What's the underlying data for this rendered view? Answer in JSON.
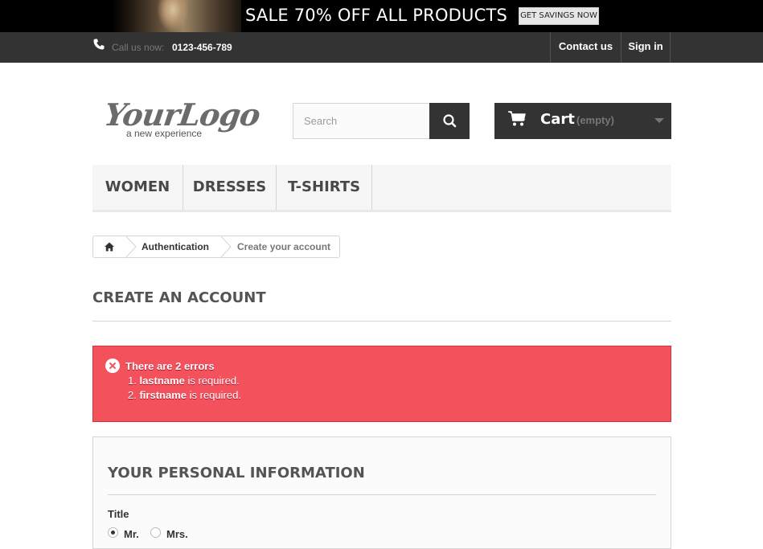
{
  "banner": {
    "text": "SALE 70% OFF ALL PRODUCTS",
    "button_label": "GET SAVINGS NOW"
  },
  "topbar": {
    "call_label": "Call us now:",
    "phone_number": "0123-456-789",
    "contact_label": "Contact us",
    "signin_label": "Sign in"
  },
  "logo": {
    "main": "YourLogo",
    "tagline": "a new experience"
  },
  "search": {
    "placeholder": "Search",
    "value": ""
  },
  "cart": {
    "label": "Cart",
    "status": "(empty)"
  },
  "menu": {
    "items": [
      {
        "label": "WOMEN"
      },
      {
        "label": "DRESSES"
      },
      {
        "label": "T-SHIRTS"
      }
    ]
  },
  "breadcrumb": {
    "items": [
      {
        "label": "Authentication"
      },
      {
        "label": "Create your account"
      }
    ]
  },
  "page": {
    "heading": "CREATE AN ACCOUNT"
  },
  "errors": {
    "title": "There are 2 errors",
    "items": [
      {
        "number": "1.",
        "field": "lastname",
        "message": "is required."
      },
      {
        "number": "2.",
        "field": "firstname",
        "message": "is required."
      }
    ]
  },
  "personal_info": {
    "heading": "YOUR PERSONAL INFORMATION",
    "title_label": "Title",
    "options": [
      {
        "label": "Mr.",
        "checked": true
      },
      {
        "label": "Mrs.",
        "checked": false
      }
    ]
  },
  "colors": {
    "dark_bar": "#333333",
    "error_bg": "#f3515c",
    "menu_bg": "#f6f6f6"
  },
  "icons": [
    "phone-icon",
    "search-icon",
    "cart-icon",
    "chevron-down-icon",
    "home-icon",
    "error-icon"
  ]
}
